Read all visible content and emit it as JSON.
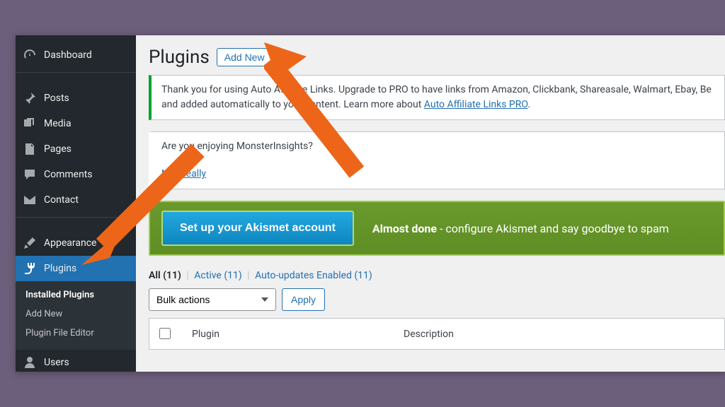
{
  "sidebar": {
    "items": [
      {
        "label": "Dashboard"
      },
      {
        "label": "Posts"
      },
      {
        "label": "Media"
      },
      {
        "label": "Pages"
      },
      {
        "label": "Comments"
      },
      {
        "label": "Contact"
      },
      {
        "label": "Appearance"
      },
      {
        "label": "Plugins"
      },
      {
        "label": "Users"
      }
    ],
    "submenu": [
      {
        "label": "Installed Plugins",
        "current": true
      },
      {
        "label": "Add New"
      },
      {
        "label": "Plugin File Editor"
      }
    ]
  },
  "page": {
    "title": "Plugins",
    "add_new": "Add New"
  },
  "notice1": {
    "text_a": "Thank you for using Auto Affiliate Links. Upgrade to PRO to have links from Amazon, Clickbank, Shareasale, Walmart, Ebay, Be",
    "text_b": "and added automatically to your content. Learn more about ",
    "link": "Auto Affiliate Links PRO",
    "dot": "."
  },
  "notice2": {
    "q": "Are you enjoying MonsterInsights?",
    "not_really": "Not Really"
  },
  "banner": {
    "cta": "Set up your Akismet account",
    "strong": "Almost done",
    "rest": " - configure Akismet and say goodbye to spam"
  },
  "filters": {
    "all": "All",
    "all_n": "(11)",
    "active": "Active",
    "active_n": "(11)",
    "auto": "Auto-updates Enabled",
    "auto_n": "(11)"
  },
  "bulk": {
    "select": "Bulk actions",
    "apply": "Apply"
  },
  "table": {
    "plugin": "Plugin",
    "description": "Description"
  }
}
